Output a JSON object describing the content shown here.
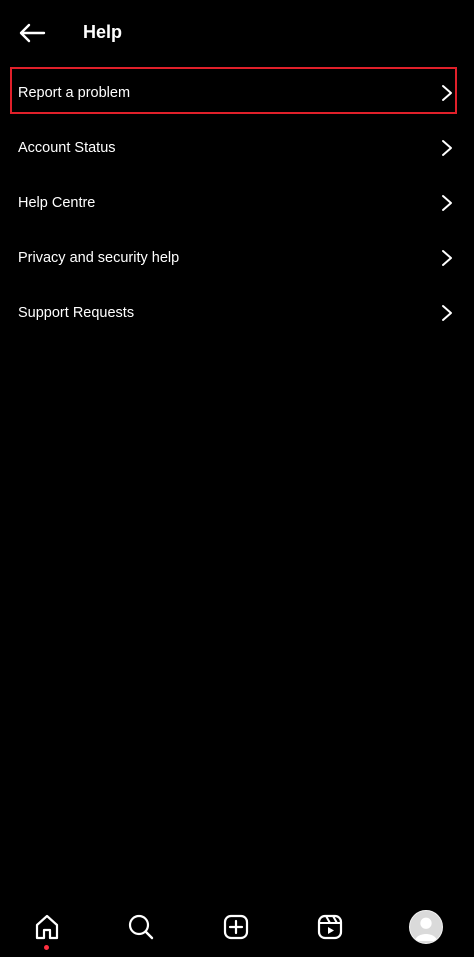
{
  "header": {
    "title": "Help",
    "back_icon": "arrow-left-icon"
  },
  "menu": {
    "items": [
      {
        "label": "Report a problem",
        "icon": "chevron-right-icon",
        "highlighted": true
      },
      {
        "label": "Account Status",
        "icon": "chevron-right-icon"
      },
      {
        "label": "Help Centre",
        "icon": "chevron-right-icon"
      },
      {
        "label": "Privacy and security help",
        "icon": "chevron-right-icon"
      },
      {
        "label": "Support Requests",
        "icon": "chevron-right-icon"
      }
    ],
    "highlight_color": "#e0202a"
  },
  "bottom_nav": {
    "items": [
      {
        "icon": "home-icon",
        "active": true
      },
      {
        "icon": "search-icon"
      },
      {
        "icon": "create-post-icon"
      },
      {
        "icon": "reels-icon"
      },
      {
        "icon": "profile-avatar"
      }
    ],
    "notification_dot_color": "#ff3040"
  },
  "colors": {
    "background": "#000000",
    "text": "#ffffff"
  }
}
